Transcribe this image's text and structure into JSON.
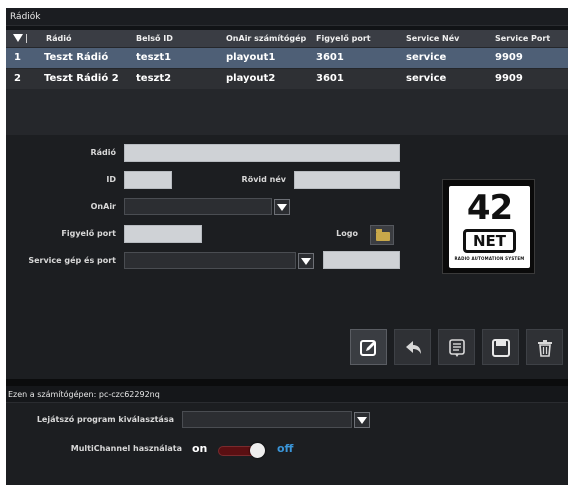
{
  "window": {
    "title": "Rádiók"
  },
  "table": {
    "headers": [
      "Rádió",
      "Belső ID",
      "OnAir számítógép",
      "Figyelő port",
      "Service Név",
      "Service Port"
    ],
    "rows": [
      {
        "num": "1",
        "radio": "Teszt Rádió",
        "id": "teszt1",
        "onair": "playout1",
        "port": "3601",
        "service_name": "service",
        "service_port": "9909",
        "selected": true
      },
      {
        "num": "2",
        "radio": "Teszt Rádió 2",
        "id": "teszt2",
        "onair": "playout2",
        "port": "3601",
        "service_name": "service",
        "service_port": "9909",
        "selected": false
      }
    ]
  },
  "form": {
    "radio_label": "Rádió",
    "radio_value": "",
    "id_label": "ID",
    "id_value": "",
    "short_name_label": "Rövid név",
    "short_name_value": "",
    "onair_label": "OnAir",
    "onair_value": "",
    "port_label": "Figyelő port",
    "port_value": "",
    "logo_label": "Logo",
    "service_label": "Service gép és port",
    "service_host_value": "",
    "service_port_value": ""
  },
  "logo": {
    "big": "42",
    "net": "NET",
    "tagline": "RADIO AUTOMATION SYSTEM"
  },
  "actions": [
    "edit-icon",
    "back-icon",
    "list-icon",
    "save-icon",
    "trash-icon"
  ],
  "bottom": {
    "title": "Ezen a számítógépen: pc-czc62292nq",
    "player_label": "Lejátszó program kiválasztása",
    "player_value": "",
    "multichannel_label": "MultiChannel használata",
    "on_text": "on",
    "off_text": "off",
    "multichannel_state": "off"
  },
  "colors": {
    "selected_row": "#4e5f76",
    "off_accent": "#3a95d8",
    "toggle_track": "#5a0f12"
  }
}
